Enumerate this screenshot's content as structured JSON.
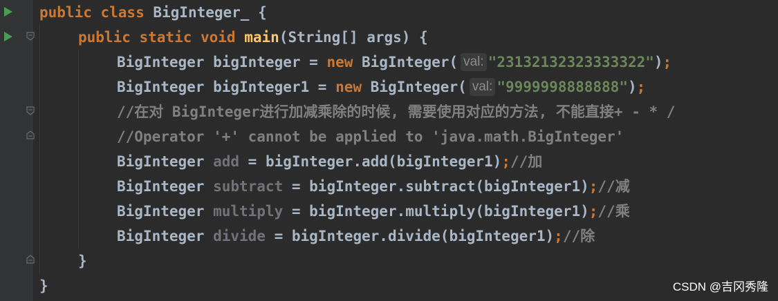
{
  "code": {
    "l1": {
      "kw": "public class ",
      "cls": "BigInteger_",
      "rest": " {"
    },
    "l2": {
      "kw": "public static void ",
      "fn": "main",
      "rest": "(String[] args) {"
    },
    "l3": {
      "a": "BigInteger bigInteger = ",
      "kw": "new",
      "b": " BigInteger(",
      "hint": "val:",
      "str": "\"23132132323333322\"",
      "c": ")",
      "semi": ";"
    },
    "l4": {
      "a": "BigInteger bigInteger1 = ",
      "kw": "new",
      "b": " BigInteger(",
      "hint": "val:",
      "str": "\"9999998888888\"",
      "c": ")",
      "semi": ";"
    },
    "l5": {
      "comment": "//在对 BigInteger进行加减乘除的时候, 需要使用对应的方法, 不能直接+ - * /"
    },
    "l6": {
      "comment": "//Operator '+' cannot be applied to 'java.math.BigInteger'"
    },
    "l7": {
      "a": "BigInteger ",
      "var": "add",
      "b": " = bigInteger.add(bigInteger1)",
      "semi": ";",
      "comment": "//加"
    },
    "l8": {
      "a": "BigInteger ",
      "var": "subtract",
      "b": " = bigInteger.subtract(bigInteger1)",
      "semi": ";",
      "comment": "//减"
    },
    "l9": {
      "a": "BigInteger ",
      "var": "multiply",
      "b": " = bigInteger.multiply(bigInteger1)",
      "semi": ";",
      "comment": "//乘"
    },
    "l10": {
      "a": "BigInteger ",
      "var": "divide",
      "b": " = bigInteger.divide(bigInteger1)",
      "semi": ";",
      "comment": "//除"
    },
    "l11": {
      "text": "}"
    },
    "l12": {
      "text": "}"
    }
  },
  "gutter": {
    "run_icon": "run-triangle-icon",
    "fold_icon": "fold-marker-icon"
  },
  "colors": {
    "background": "#2b2b2b",
    "keyword": "#cc7832",
    "string": "#6a8759",
    "comment": "#808080",
    "function": "#ffc66d",
    "text": "#a9b7c6",
    "run": "#499c54"
  },
  "watermark": "CSDN @吉冈秀隆"
}
